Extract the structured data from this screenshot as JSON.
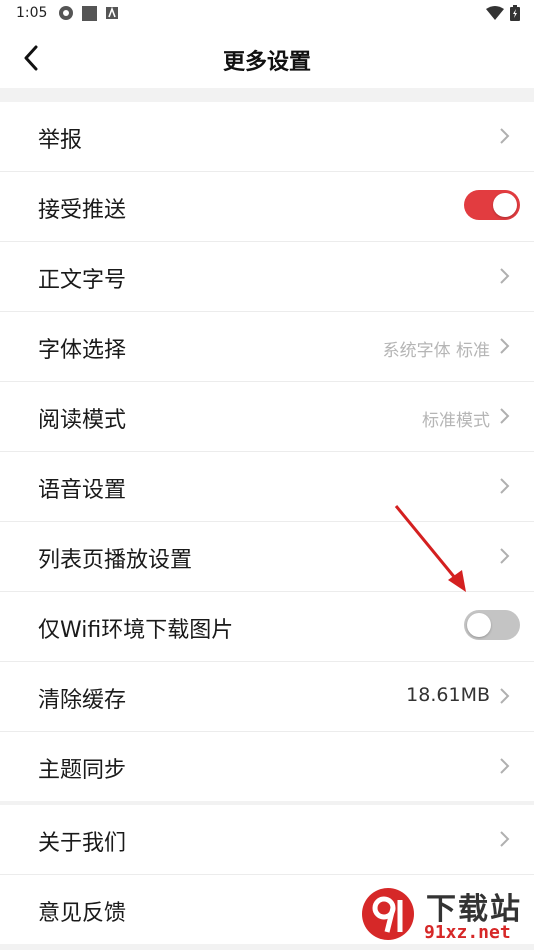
{
  "status_bar": {
    "time": "1:05"
  },
  "header": {
    "title": "更多设置"
  },
  "groups": [
    {
      "rows": [
        {
          "label": "举报"
        },
        {
          "label": "接受推送",
          "toggle": "on"
        },
        {
          "label": "正文字号"
        },
        {
          "label": "字体选择",
          "value": "系统字体 标准"
        },
        {
          "label": "阅读模式",
          "value": "标准模式"
        },
        {
          "label": "语音设置"
        },
        {
          "label": "列表页播放设置"
        },
        {
          "label": "仅Wifi环境下载图片",
          "toggle": "off"
        },
        {
          "label": "清除缓存",
          "value": "18.61MB"
        },
        {
          "label": "主题同步"
        }
      ]
    },
    {
      "rows": [
        {
          "label": "关于我们"
        },
        {
          "label": "意见反馈"
        }
      ]
    }
  ],
  "watermark": {
    "text_big": "下载站",
    "text_small": "91xz.net"
  },
  "colors": {
    "toggle_on": "#e23c40",
    "toggle_off": "#c4c4c4",
    "annotation_arrow": "#d42020",
    "watermark_red": "#d62828"
  }
}
